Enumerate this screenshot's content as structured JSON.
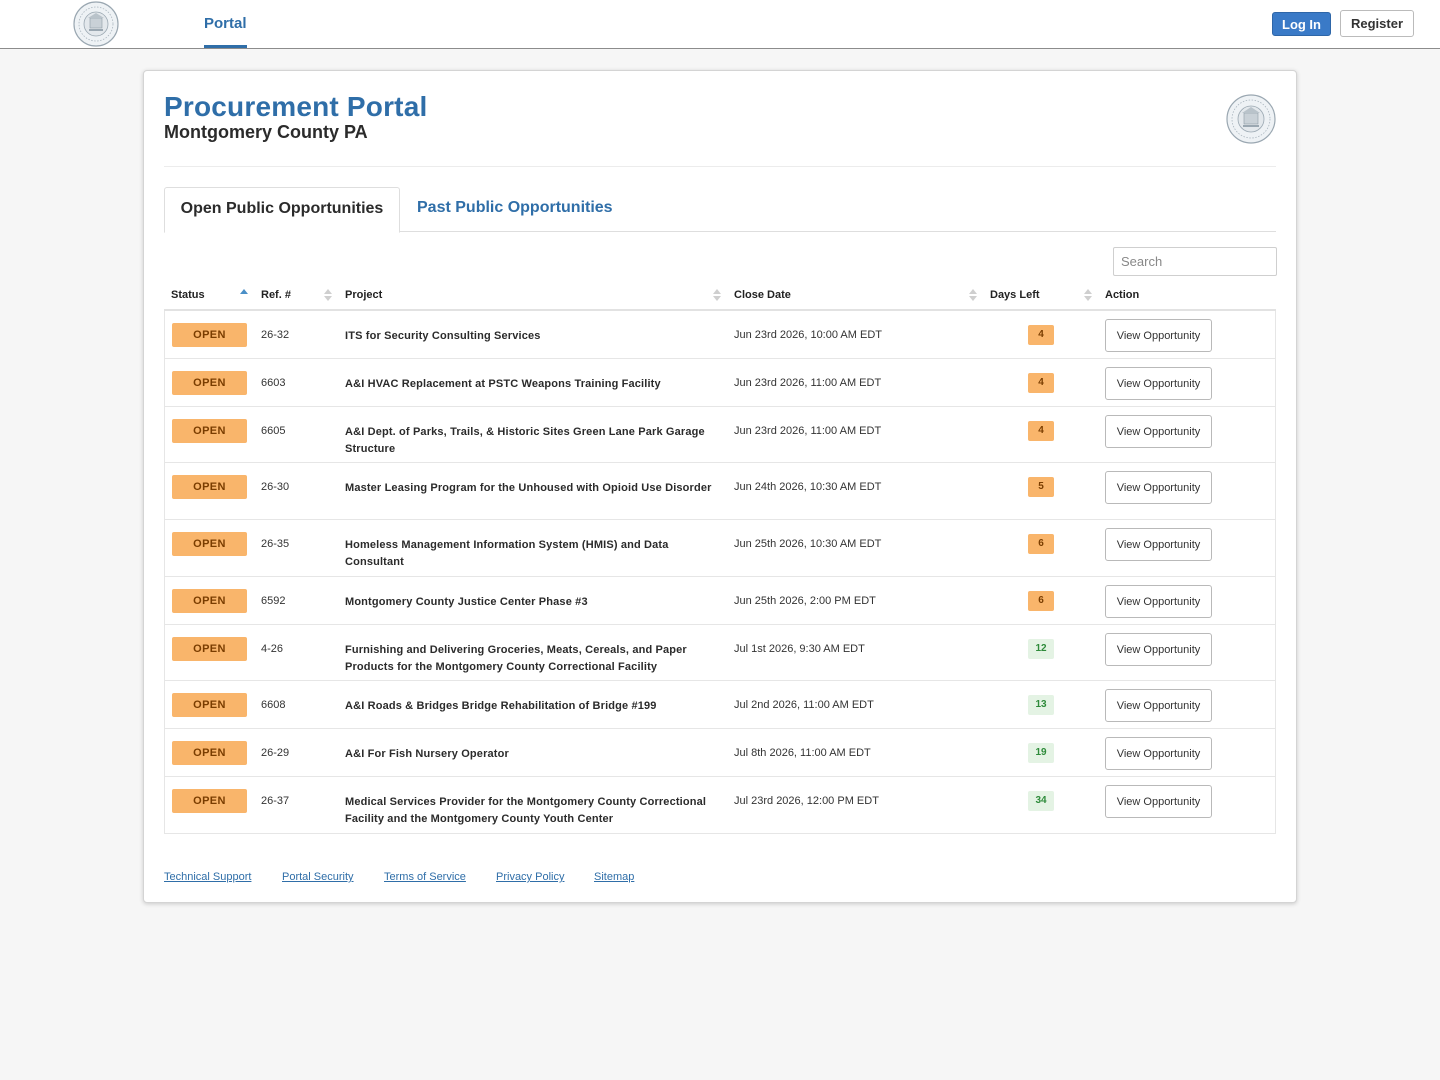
{
  "nav": {
    "portal_tab": "Portal",
    "login_label": "Log In",
    "register_label": "Register"
  },
  "header": {
    "title": "Procurement Portal",
    "subtitle": "Montgomery County PA"
  },
  "tabs": [
    {
      "label": "Open Public Opportunities",
      "active": true
    },
    {
      "label": "Past Public Opportunities",
      "active": false
    }
  ],
  "search": {
    "placeholder": "Search",
    "value": ""
  },
  "table": {
    "columns": [
      "Status",
      "Ref. #",
      "Project",
      "Close Date",
      "Days Left",
      "Action"
    ],
    "sort": {
      "column": "Status",
      "direction": "ascending"
    },
    "rows": [
      {
        "status": "OPEN",
        "ref": "26-32",
        "project": "ITS for Security Consulting Services",
        "close_date": "Jun 23rd 2026, 10:00 AM EDT",
        "days_left": "4",
        "days_state": "warn",
        "action": "View Opportunity"
      },
      {
        "status": "OPEN",
        "ref": "6603",
        "project": "A&I HVAC Replacement at PSTC Weapons Training Facility",
        "close_date": "Jun 23rd 2026, 11:00 AM EDT",
        "days_left": "4",
        "days_state": "warn",
        "action": "View Opportunity"
      },
      {
        "status": "OPEN",
        "ref": "6605",
        "project": "A&I Dept. of Parks, Trails, & Historic Sites Green Lane Park Garage Structure",
        "close_date": "Jun 23rd 2026, 11:00 AM EDT",
        "days_left": "4",
        "days_state": "warn",
        "action": "View Opportunity"
      },
      {
        "status": "OPEN",
        "ref": "26-30",
        "project": "Master Leasing Program for the Unhoused with Opioid Use Disorder",
        "close_date": "Jun 24th 2026, 10:30 AM EDT",
        "days_left": "5",
        "days_state": "warn",
        "action": "View Opportunity"
      },
      {
        "status": "OPEN",
        "ref": "26-35",
        "project": "Homeless Management Information System (HMIS) and Data Consultant",
        "close_date": "Jun 25th 2026, 10:30 AM EDT",
        "days_left": "6",
        "days_state": "warn",
        "action": "View Opportunity"
      },
      {
        "status": "OPEN",
        "ref": "6592",
        "project": "Montgomery County Justice Center Phase #3",
        "close_date": "Jun 25th 2026, 2:00 PM EDT",
        "days_left": "6",
        "days_state": "warn",
        "action": "View Opportunity"
      },
      {
        "status": "OPEN",
        "ref": "4-26",
        "project": "Furnishing and Delivering Groceries, Meats, Cereals, and Paper Products for the Montgomery County Correctional Facility",
        "close_date": "Jul 1st 2026, 9:30 AM EDT",
        "days_left": "12",
        "days_state": "ok",
        "action": "View Opportunity"
      },
      {
        "status": "OPEN",
        "ref": "6608",
        "project": "A&I Roads & Bridges Bridge Rehabilitation of Bridge #199",
        "close_date": "Jul 2nd 2026, 11:00 AM EDT",
        "days_left": "13",
        "days_state": "ok",
        "action": "View Opportunity"
      },
      {
        "status": "OPEN",
        "ref": "26-29",
        "project": "A&I For Fish Nursery Operator",
        "close_date": "Jul 8th 2026, 11:00 AM EDT",
        "days_left": "19",
        "days_state": "ok",
        "action": "View Opportunity"
      },
      {
        "status": "OPEN",
        "ref": "26-37",
        "project": "Medical Services Provider for the Montgomery County Correctional Facility and the Montgomery County Youth Center",
        "close_date": "Jul 23rd 2026, 12:00 PM EDT",
        "days_left": "34",
        "days_state": "ok",
        "action": "View Opportunity"
      }
    ]
  },
  "footer": {
    "links": [
      "Technical Support",
      "Portal Security",
      "Terms of Service",
      "Privacy Policy",
      "Sitemap"
    ]
  },
  "colors": {
    "brand_blue": "#2f6ea8",
    "login_blue": "#3a7ac7",
    "status_orange": "#f9b56b",
    "days_ok_bg": "#e4f3e4",
    "days_ok_text": "#2e8b3a"
  },
  "icons": {
    "logo": "county-seal-icon",
    "sort_active": "sort-asc-icon",
    "sort_idle": "sort-both-icon"
  }
}
